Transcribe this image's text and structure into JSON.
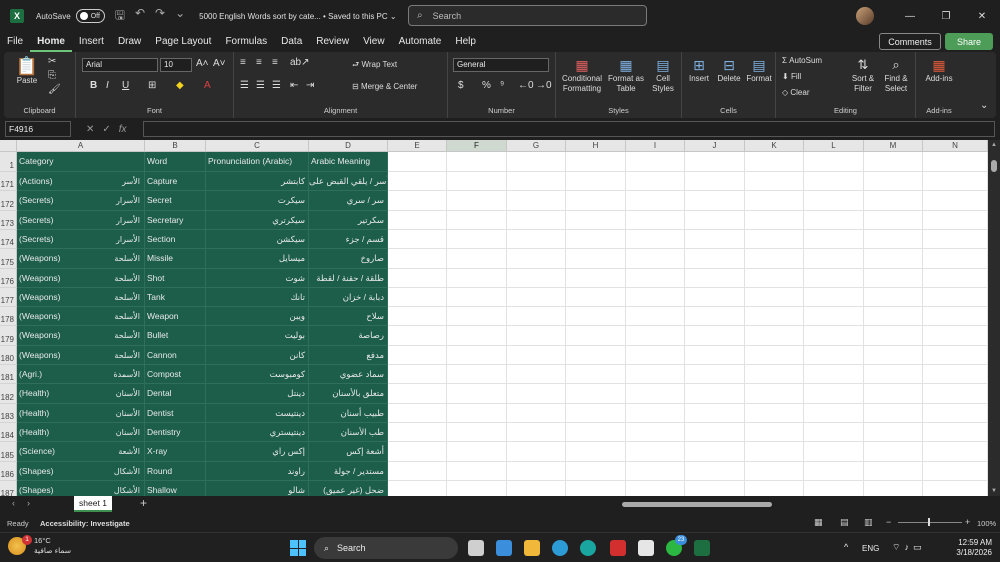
{
  "titlebar": {
    "autosave_label": "AutoSave",
    "autosave_state": "Off",
    "doc_title": "5000 English Words sort by cate...  •  Saved to this PC  ⌄",
    "search_placeholder": "Search"
  },
  "menu": {
    "tabs": [
      "File",
      "Home",
      "Insert",
      "Draw",
      "Page Layout",
      "Formulas",
      "Data",
      "Review",
      "View",
      "Automate",
      "Help"
    ],
    "active": "Home",
    "comments_label": "Comments",
    "share_label": "Share"
  },
  "ribbon": {
    "clipboard": {
      "label": "Clipboard",
      "paste": "Paste"
    },
    "font": {
      "label": "Font",
      "name": "Arial",
      "size": "10",
      "bold": "B",
      "italic": "I",
      "underline": "U"
    },
    "alignment": {
      "label": "Alignment",
      "wrap": "Wrap Text",
      "merge": "Merge & Center"
    },
    "number": {
      "label": "Number",
      "format": "General"
    },
    "styles": {
      "label": "Styles",
      "conditional": "Conditional Formatting",
      "format_table": "Format as Table",
      "cell_styles": "Cell Styles"
    },
    "cells": {
      "label": "Cells",
      "insert": "Insert",
      "delete": "Delete",
      "format": "Format"
    },
    "editing": {
      "label": "Editing",
      "autosum": "AutoSum",
      "fill": "Fill",
      "clear": "Clear",
      "sort": "Sort & Filter",
      "find": "Find & Select"
    },
    "addins": {
      "label": "Add-ins",
      "button": "Add-ins"
    }
  },
  "formula_bar": {
    "name_box": "F4916",
    "fx": "fx",
    "value": ""
  },
  "columns": [
    "A",
    "B",
    "C",
    "D",
    "E",
    "F",
    "G",
    "H",
    "I",
    "J",
    "K",
    "L",
    "M",
    "N"
  ],
  "selected_column": "F",
  "header_row": {
    "num": "1",
    "a": "Category",
    "b": "Word",
    "c": "Pronunciation (Arabic)",
    "d": "Arabic Meaning"
  },
  "rows": [
    {
      "num": "171",
      "cat_en": "(Actions)",
      "cat_ar": "الأسر",
      "word": "Capture",
      "pron": "كابتشر",
      "meaning": "يأسر / يلقي القبض على"
    },
    {
      "num": "172",
      "cat_en": "(Secrets)",
      "cat_ar": "الأسرار",
      "word": "Secret",
      "pron": "سيكرت",
      "meaning": "سر / سري"
    },
    {
      "num": "173",
      "cat_en": "(Secrets)",
      "cat_ar": "الأسرار",
      "word": "Secretary",
      "pron": "سيكرتري",
      "meaning": "سكرتير"
    },
    {
      "num": "174",
      "cat_en": "(Secrets)",
      "cat_ar": "الأسرار",
      "word": "Section",
      "pron": "سيكشن",
      "meaning": "قسم / جزء"
    },
    {
      "num": "175",
      "cat_en": "(Weapons)",
      "cat_ar": "الأسلحة",
      "word": "Missile",
      "pron": "ميسايل",
      "meaning": "صاروخ"
    },
    {
      "num": "176",
      "cat_en": "(Weapons)",
      "cat_ar": "الأسلحة",
      "word": "Shot",
      "pron": "شوت",
      "meaning": "طلقة / حقنة / لقطة"
    },
    {
      "num": "177",
      "cat_en": "(Weapons)",
      "cat_ar": "الأسلحة",
      "word": "Tank",
      "pron": "تانك",
      "meaning": "دبابة / خزان"
    },
    {
      "num": "178",
      "cat_en": "(Weapons)",
      "cat_ar": "الأسلحة",
      "word": "Weapon",
      "pron": "ويبن",
      "meaning": "سلاح"
    },
    {
      "num": "179",
      "cat_en": "(Weapons)",
      "cat_ar": "الأسلحة",
      "word": "Bullet",
      "pron": "بوليت",
      "meaning": "رصاصة"
    },
    {
      "num": "180",
      "cat_en": "(Weapons)",
      "cat_ar": "الأسلحة",
      "word": "Cannon",
      "pron": "كانن",
      "meaning": "مدفع"
    },
    {
      "num": "181",
      "cat_en": "(Agri.)",
      "cat_ar": "الأسمدة",
      "word": "Compost",
      "pron": "كومبوست",
      "meaning": "سماد عضوي"
    },
    {
      "num": "182",
      "cat_en": "(Health)",
      "cat_ar": "الأسنان",
      "word": "Dental",
      "pron": "دينتل",
      "meaning": "متعلق بالأسنان"
    },
    {
      "num": "183",
      "cat_en": "(Health)",
      "cat_ar": "الأسنان",
      "word": "Dentist",
      "pron": "دينتيست",
      "meaning": "طبيب أسنان"
    },
    {
      "num": "184",
      "cat_en": "(Health)",
      "cat_ar": "الأسنان",
      "word": "Dentistry",
      "pron": "دينتيستري",
      "meaning": "طب الأسنان"
    },
    {
      "num": "185",
      "cat_en": "(Science)",
      "cat_ar": "الأشعة",
      "word": "X-ray",
      "pron": "إكس راي",
      "meaning": "أشعة إكس"
    },
    {
      "num": "186",
      "cat_en": "(Shapes)",
      "cat_ar": "الأشكال",
      "word": "Round",
      "pron": "راوند",
      "meaning": "مستدير / جولة"
    },
    {
      "num": "187",
      "cat_en": "(Shapes)",
      "cat_ar": "الأشكال",
      "word": "Shallow",
      "pron": "شالو",
      "meaning": "ضحل (غير عميق)"
    }
  ],
  "sheet": {
    "tab_name": "sheet 1",
    "add": "+"
  },
  "status": {
    "ready": "Ready",
    "accessibility": "Accessibility: Investigate",
    "zoom": "100%"
  },
  "taskbar": {
    "weather_temp": "16°C",
    "weather_desc": "سماء صافية",
    "weather_badge": "1",
    "search": "Search",
    "whatsapp_badge": "23",
    "lang": "ENG",
    "time": "12:59 AM",
    "date": "3/18/2026"
  },
  "colors": {
    "header_green": "#1c5e4a",
    "accent": "#4d9c58"
  }
}
